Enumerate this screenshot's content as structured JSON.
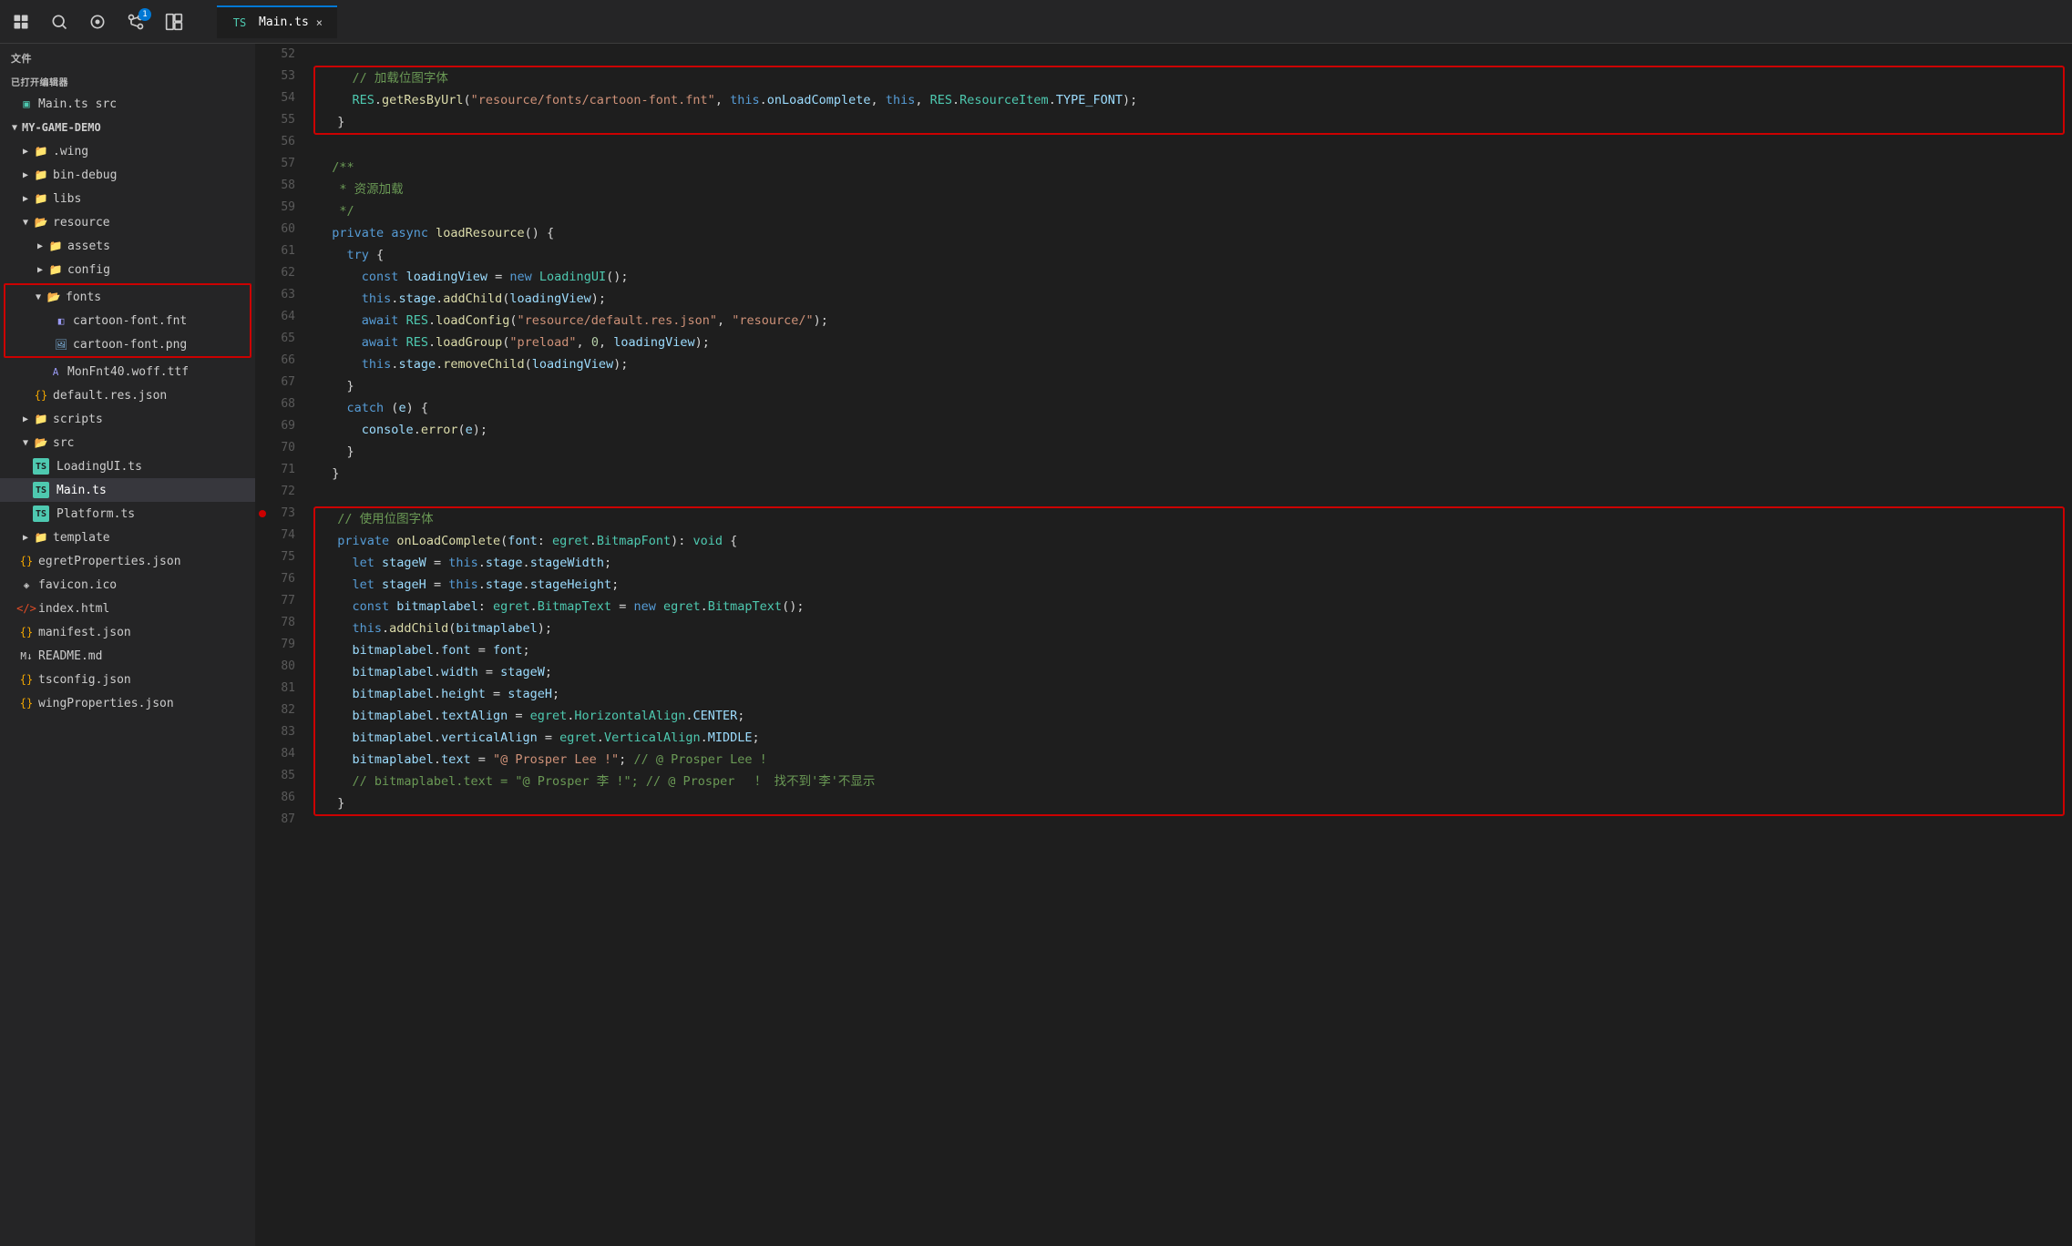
{
  "titleBar": {
    "icons": [
      "file-icon",
      "search-icon",
      "extensions-icon",
      "git-icon",
      "layout-icon"
    ]
  },
  "tab": {
    "filename": "Main.ts",
    "close_label": "×",
    "icon": "ts"
  },
  "sidebar": {
    "section_title": "文件",
    "opened_editors": "已打开编辑器",
    "opened_file": "Main.ts src",
    "project_name": "MY-GAME-DEMO",
    "items": [
      {
        "label": ".wing",
        "type": "folder",
        "indent": 1,
        "collapsed": true
      },
      {
        "label": "bin-debug",
        "type": "folder",
        "indent": 1,
        "collapsed": true
      },
      {
        "label": "libs",
        "type": "folder",
        "indent": 1,
        "collapsed": true
      },
      {
        "label": "resource",
        "type": "folder",
        "indent": 1,
        "collapsed": false
      },
      {
        "label": "assets",
        "type": "folder",
        "indent": 2,
        "collapsed": true
      },
      {
        "label": "config",
        "type": "folder",
        "indent": 2,
        "collapsed": true
      },
      {
        "label": "fonts",
        "type": "folder",
        "indent": 2,
        "collapsed": false,
        "highlighted": true
      },
      {
        "label": "cartoon-font.fnt",
        "type": "fnt",
        "indent": 3
      },
      {
        "label": "cartoon-font.png",
        "type": "png",
        "indent": 3
      },
      {
        "label": "MonFnt40.woff.ttf",
        "type": "ttf",
        "indent": 3
      },
      {
        "label": "default.res.json",
        "type": "json",
        "indent": 2
      },
      {
        "label": "scripts",
        "type": "folder",
        "indent": 1,
        "collapsed": true
      },
      {
        "label": "src",
        "type": "folder",
        "indent": 1,
        "collapsed": false
      },
      {
        "label": "LoadingUI.ts",
        "type": "ts",
        "indent": 2
      },
      {
        "label": "Main.ts",
        "type": "ts",
        "indent": 2,
        "active": true
      },
      {
        "label": "Platform.ts",
        "type": "ts",
        "indent": 2
      },
      {
        "label": "template",
        "type": "folder",
        "indent": 1,
        "collapsed": true
      },
      {
        "label": "egretProperties.json",
        "type": "json",
        "indent": 1
      },
      {
        "label": "favicon.ico",
        "type": "ico",
        "indent": 1
      },
      {
        "label": "index.html",
        "type": "html",
        "indent": 1
      },
      {
        "label": "manifest.json",
        "type": "json",
        "indent": 1
      },
      {
        "label": "README.md",
        "type": "md",
        "indent": 1
      },
      {
        "label": "tsconfig.json",
        "type": "json",
        "indent": 1
      },
      {
        "label": "wingProperties.json",
        "type": "json",
        "indent": 1
      }
    ]
  },
  "editor": {
    "lines": [
      {
        "num": 52,
        "content": ""
      },
      {
        "num": 53,
        "content": "    // 加载位图字体",
        "comment": true
      },
      {
        "num": 54,
        "content": "    RES.getResByUrl(\"resource/fonts/cartoon-font.fnt\", this.onLoadComplete, this, RES.ResourceItem.TYPE_FONT);"
      },
      {
        "num": 55,
        "content": "  }"
      },
      {
        "num": 56,
        "content": ""
      },
      {
        "num": 57,
        "content": "  /**"
      },
      {
        "num": 58,
        "content": "   * 资源加载",
        "comment": true
      },
      {
        "num": 59,
        "content": "   */",
        "comment": true
      },
      {
        "num": 60,
        "content": "  private async loadResource() {"
      },
      {
        "num": 61,
        "content": "    try {"
      },
      {
        "num": 62,
        "content": "      const loadingView = new LoadingUI();"
      },
      {
        "num": 63,
        "content": "      this.stage.addChild(loadingView);"
      },
      {
        "num": 64,
        "content": "      await RES.loadConfig(\"resource/default.res.json\", \"resource/\");"
      },
      {
        "num": 65,
        "content": "      await RES.loadGroup(\"preload\", 0, loadingView);"
      },
      {
        "num": 66,
        "content": "      this.stage.removeChild(loadingView);"
      },
      {
        "num": 67,
        "content": "    }"
      },
      {
        "num": 68,
        "content": "    catch (e) {"
      },
      {
        "num": 69,
        "content": "      console.error(e);"
      },
      {
        "num": 70,
        "content": "    }"
      },
      {
        "num": 71,
        "content": "  }"
      },
      {
        "num": 72,
        "content": ""
      },
      {
        "num": 73,
        "content": "  // 使用位图字体",
        "comment": true
      },
      {
        "num": 74,
        "content": "  private onLoadComplete(font: egret.BitmapFont): void {"
      },
      {
        "num": 75,
        "content": "    let stageW = this.stage.stageWidth;"
      },
      {
        "num": 76,
        "content": "    let stageH = this.stage.stageHeight;"
      },
      {
        "num": 77,
        "content": "    const bitmaplabel: egret.BitmapText = new egret.BitmapText();"
      },
      {
        "num": 78,
        "content": "    this.addChild(bitmaplabel);"
      },
      {
        "num": 79,
        "content": "    bitmaplabel.font = font;"
      },
      {
        "num": 80,
        "content": "    bitmaplabel.width = stageW;"
      },
      {
        "num": 81,
        "content": "    bitmaplabel.height = stageH;"
      },
      {
        "num": 82,
        "content": "    bitmaplabel.textAlign = egret.HorizontalAlign.CENTER;"
      },
      {
        "num": 83,
        "content": "    bitmaplabel.verticalAlign = egret.VerticalAlign.MIDDLE;"
      },
      {
        "num": 84,
        "content": "    bitmaplabel.text = \"@ Prosper Lee !\"; // @ Prosper Lee !"
      },
      {
        "num": 85,
        "content": "    // bitmaplabel.text = \"@ Prosper 李 !\"; // @ Prosper 　！ 找不到'李'不显示"
      },
      {
        "num": 86,
        "content": "  }"
      },
      {
        "num": 87,
        "content": ""
      }
    ]
  }
}
